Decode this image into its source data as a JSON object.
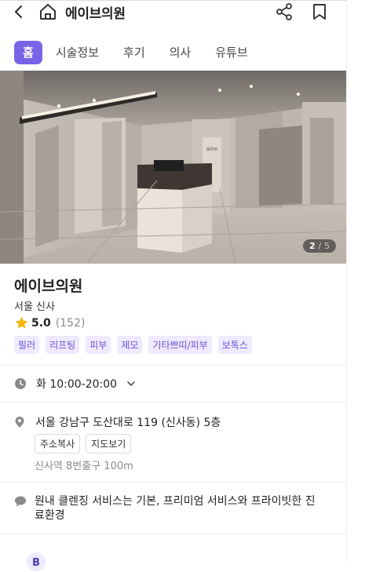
{
  "header": {
    "title": "에이브의원"
  },
  "tabs": [
    {
      "label": "홈",
      "active": true
    },
    {
      "label": "시술정보"
    },
    {
      "label": "후기"
    },
    {
      "label": "의사"
    },
    {
      "label": "유튜브"
    }
  ],
  "gallery": {
    "current": "2",
    "total": "5",
    "separator": "/"
  },
  "clinic": {
    "name": "에이브의원",
    "location": "서울 신사",
    "rating": "5.0",
    "review_count": "(152)"
  },
  "tags": [
    "필러",
    "리프팅",
    "피부",
    "제모",
    "기타쁘띠/피부",
    "보톡스"
  ],
  "hours": {
    "text": "화 10:00-20:00"
  },
  "address": {
    "text": "서울 강남구 도산대로 119 (신사동) 5층",
    "copy_button": "주소복사",
    "map_button": "지도보기",
    "subway": "신사역 8번출구 100m"
  },
  "description": "원내 클렌징 서비스는 기본, 프리미엄 서비스와 프라이빗한 진료환경",
  "colors": {
    "accent": "#7b63e7",
    "tag_bg": "#efeaff",
    "tag_text": "#6b55d4",
    "star": "#f5b400"
  }
}
